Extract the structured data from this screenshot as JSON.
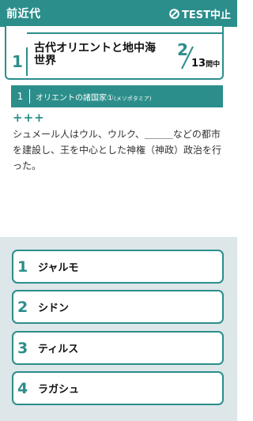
{
  "header": {
    "era": "前近代",
    "quit_label": "TEST中止"
  },
  "chapter": {
    "number": "1",
    "title": "古代オリエントと地中海世界"
  },
  "progress": {
    "current": "2",
    "total": "13",
    "total_suffix": "問中"
  },
  "section": {
    "number": "1",
    "label": "オリエントの諸国家①",
    "sub": "(メソポタミア)"
  },
  "question": {
    "marks": "+++",
    "text": "シュメール人はウル、ウルク、＿＿＿などの都市を建設し、王を中心とした神権（神政）政治を行った。"
  },
  "options": [
    {
      "number": "1",
      "label": "ジャルモ"
    },
    {
      "number": "2",
      "label": "シドン"
    },
    {
      "number": "3",
      "label": "ティルス"
    },
    {
      "number": "4",
      "label": "ラガシュ"
    }
  ],
  "colors": {
    "accent": "#2b8e8b",
    "answer_bg": "#dde6e9"
  }
}
